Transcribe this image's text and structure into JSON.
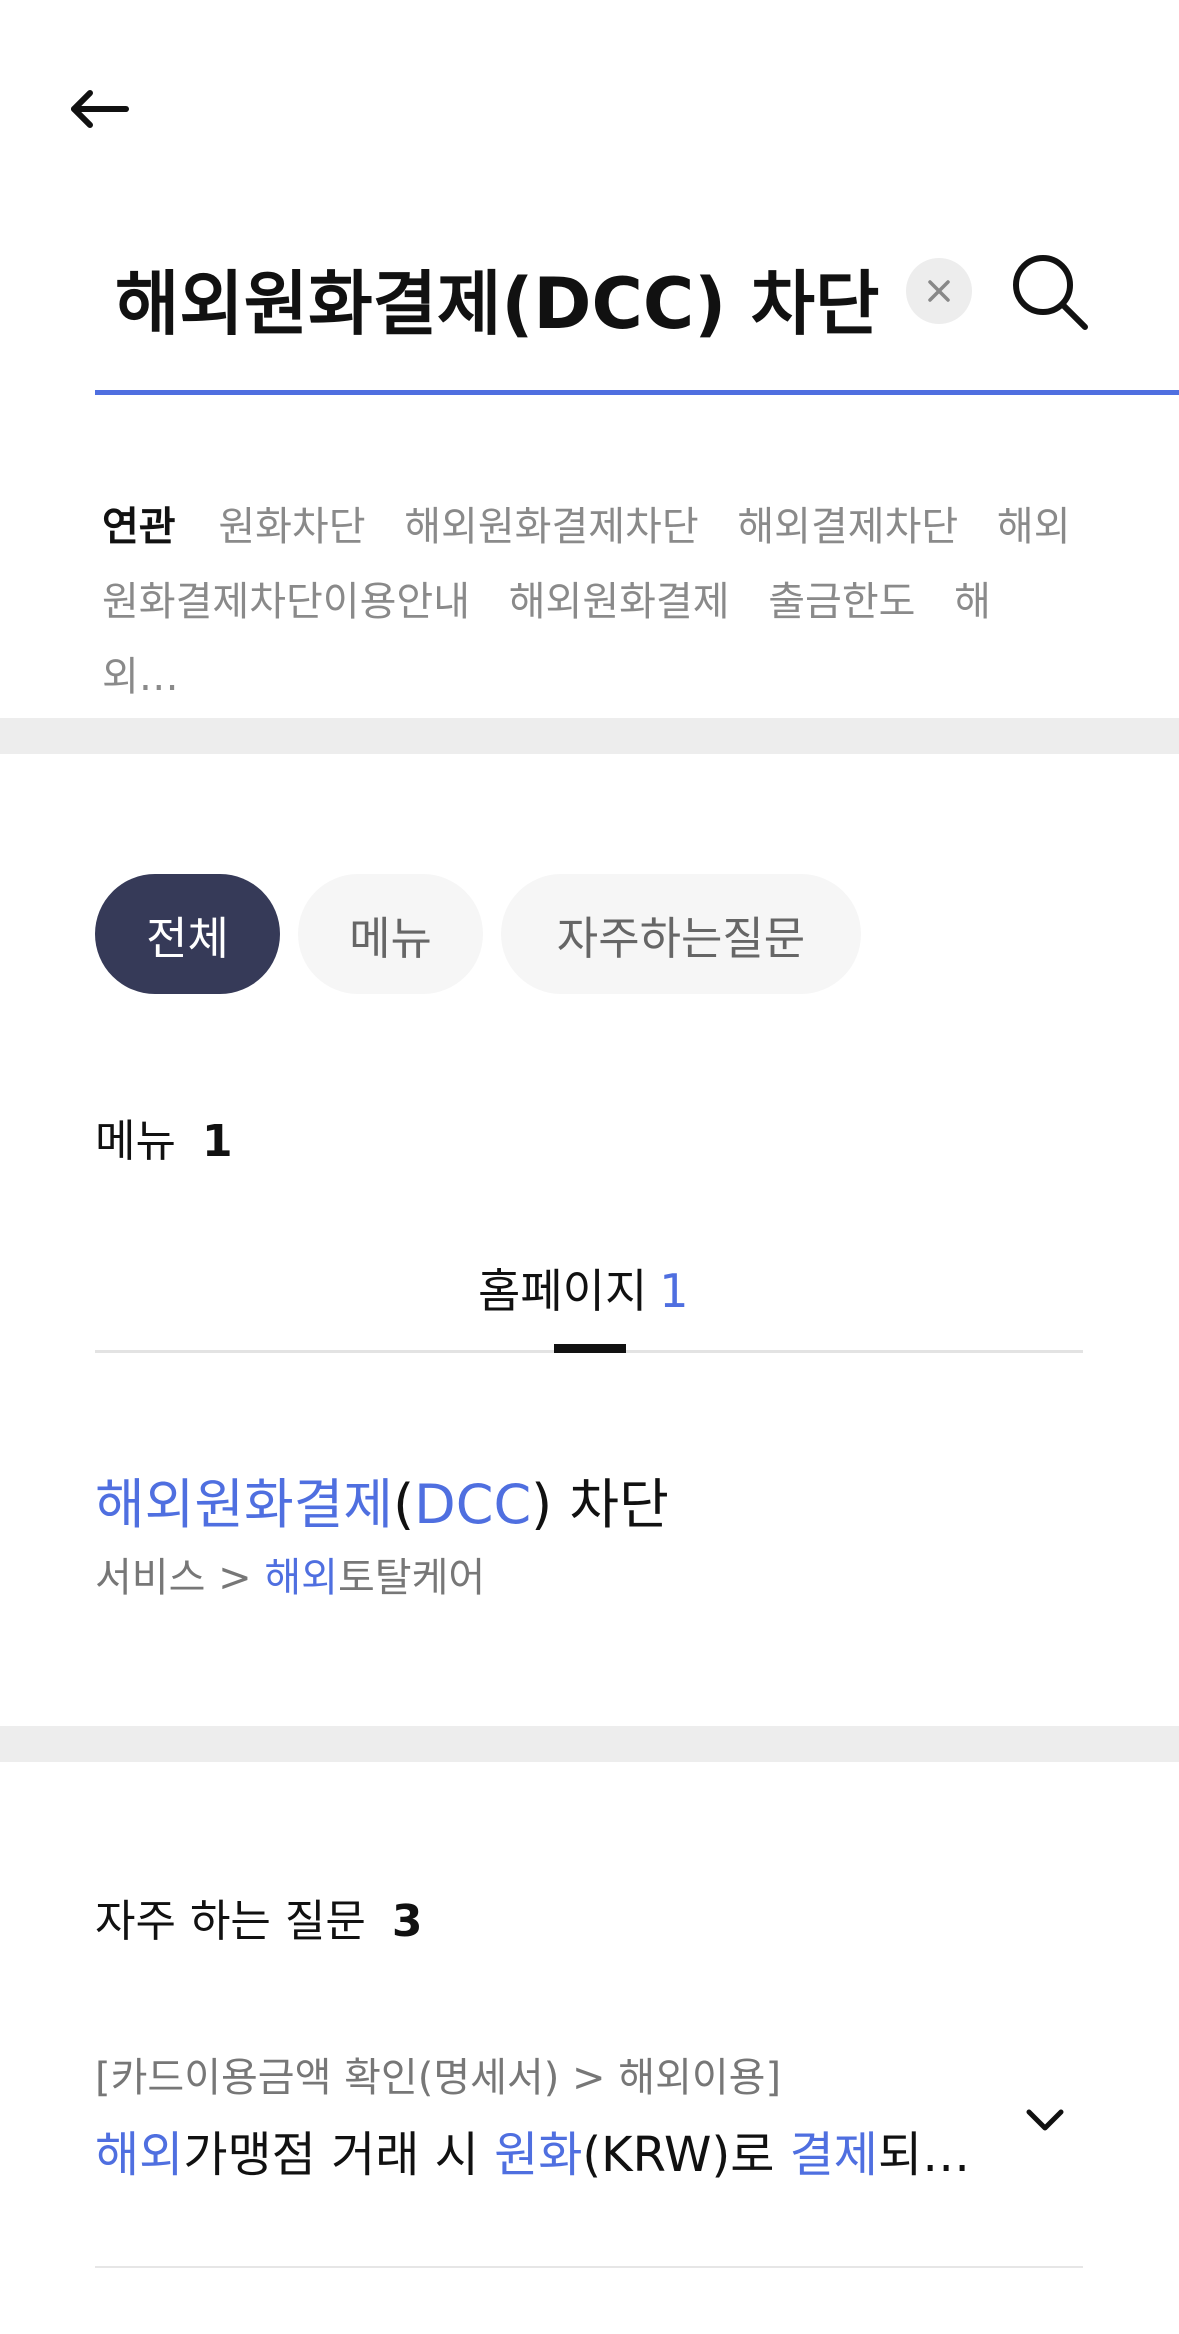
{
  "header": {
    "back_icon": "back-arrow-icon"
  },
  "search": {
    "query": "해외원화결제(DCC) 차단",
    "clear_icon": "close-icon",
    "search_icon": "search-icon",
    "accent_color": "#4f6fe0"
  },
  "related": {
    "label": "연관",
    "keywords": [
      "원화차단",
      "해외원화결제차단",
      "해외결제차단",
      "해외원화결제차단이용안내",
      "해외원화결제",
      "출금한도",
      "해외…"
    ]
  },
  "filter_tabs": [
    {
      "label": "전체",
      "active": true
    },
    {
      "label": "메뉴",
      "active": false
    },
    {
      "label": "자주하는질문",
      "active": false
    }
  ],
  "menu_section": {
    "title": "메뉴",
    "count": "1",
    "subtab": {
      "label": "홈페이지",
      "count": "1"
    },
    "result": {
      "title_parts": [
        {
          "text": "해외원화결제",
          "hl": true
        },
        {
          "text": "(",
          "hl": false
        },
        {
          "text": "DCC",
          "hl": true
        },
        {
          "text": ") 차단",
          "hl": false
        }
      ],
      "path_parts": [
        {
          "text": "서비스 > ",
          "hl": false
        },
        {
          "text": "해외",
          "hl": true
        },
        {
          "text": "토탈케어",
          "hl": false
        }
      ]
    }
  },
  "faq_section": {
    "title": "자주 하는 질문",
    "count": "3",
    "item": {
      "category": "[카드이용금액 확인(명세서) > 해외이용]",
      "question_parts": [
        {
          "text": "해외",
          "hl": true
        },
        {
          "text": "가맹점 거래 시 ",
          "hl": false
        },
        {
          "text": "원화",
          "hl": true
        },
        {
          "text": "(KRW)로 ",
          "hl": false
        },
        {
          "text": "결제",
          "hl": true
        },
        {
          "text": "되…",
          "hl": false
        }
      ],
      "toggle_icon": "chevron-down-icon"
    }
  }
}
